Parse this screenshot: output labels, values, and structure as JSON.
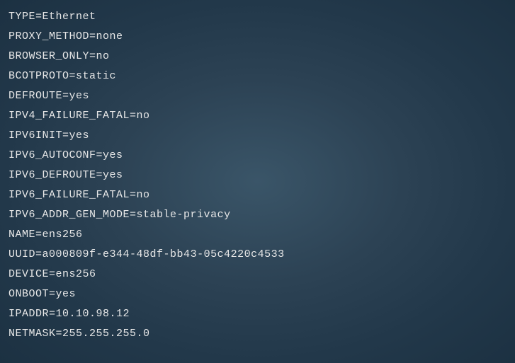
{
  "config": {
    "lines": [
      {
        "key": "TYPE",
        "value": "Ethernet"
      },
      {
        "key": "PROXY_METHOD",
        "value": "none"
      },
      {
        "key": "BROWSER_ONLY",
        "value": "no"
      },
      {
        "key": "BCOTPROTO",
        "value": "static"
      },
      {
        "key": "DEFROUTE",
        "value": "yes"
      },
      {
        "key": "IPV4_FAILURE_FATAL",
        "value": "no"
      },
      {
        "key": "IPV6INIT",
        "value": "yes"
      },
      {
        "key": "IPV6_AUTOCONF",
        "value": "yes"
      },
      {
        "key": "IPV6_DEFROUTE",
        "value": "yes"
      },
      {
        "key": "IPV6_FAILURE_FATAL",
        "value": "no"
      },
      {
        "key": "IPV6_ADDR_GEN_MODE",
        "value": "stable-privacy"
      },
      {
        "key": "NAME",
        "value": "ens256"
      },
      {
        "key": "UUID",
        "value": "a000809f-e344-48df-bb43-05c4220c4533"
      },
      {
        "key": "DEVICE",
        "value": "ens256"
      },
      {
        "key": "ONBOOT",
        "value": "yes"
      },
      {
        "key": "IPADDR",
        "value": "10.10.98.12"
      },
      {
        "key": "NETMASK",
        "value": "255.255.255.0"
      }
    ],
    "separator": "="
  }
}
